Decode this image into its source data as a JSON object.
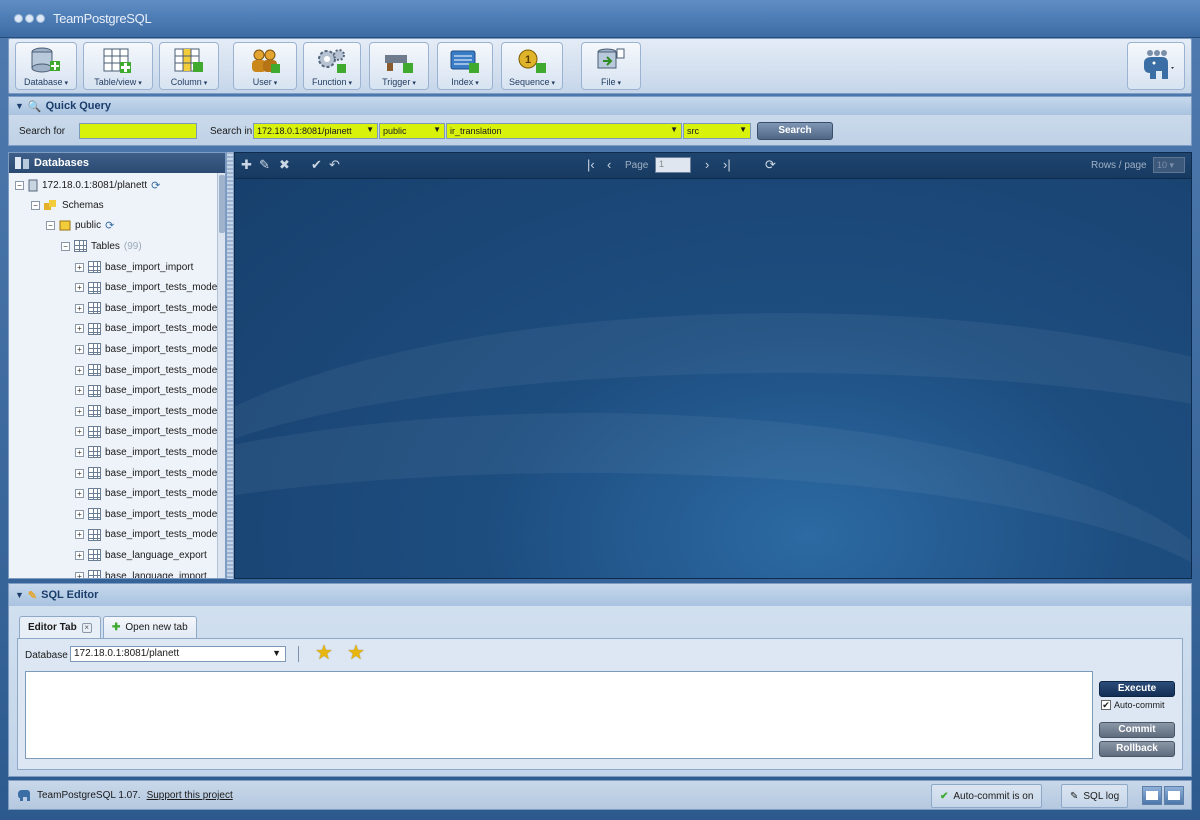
{
  "app": {
    "title": "TeamPostgreSQL"
  },
  "toolbar": {
    "buttons": [
      {
        "label": "Database",
        "icon": "database-add-icon"
      },
      {
        "label": "Table/view",
        "icon": "table-add-icon"
      },
      {
        "label": "Column",
        "icon": "column-add-icon"
      },
      {
        "label": "User",
        "icon": "users-icon"
      },
      {
        "label": "Function",
        "icon": "gears-icon"
      },
      {
        "label": "Trigger",
        "icon": "trigger-icon"
      },
      {
        "label": "Index",
        "icon": "index-icon"
      },
      {
        "label": "Sequence",
        "icon": "sequence-icon"
      },
      {
        "label": "File",
        "icon": "file-export-icon"
      }
    ]
  },
  "quick_query": {
    "title": "Quick Query",
    "search_for_label": "Search for",
    "search_for_value": "",
    "search_in_label": "Search in",
    "database_value": "172.18.0.1:8081/planett",
    "schema_value": "public",
    "table_value": "ir_translation",
    "column_value": "src",
    "search_button": "Search"
  },
  "databases": {
    "title": "Databases",
    "connection": "172.18.0.1:8081/planett",
    "schemas_label": "Schemas",
    "schema_name": "public",
    "tables_label": "Tables",
    "tables_count": "(99)",
    "tables": [
      "base_import_import",
      "base_import_tests_models",
      "base_import_tests_models",
      "base_import_tests_models",
      "base_import_tests_models",
      "base_import_tests_models",
      "base_import_tests_models",
      "base_import_tests_models",
      "base_import_tests_models",
      "base_import_tests_models",
      "base_import_tests_models",
      "base_import_tests_models",
      "base_import_tests_models",
      "base_import_tests_models",
      "base_language_export",
      "base_language_import"
    ]
  },
  "grid": {
    "page_label": "Page",
    "page_value": "1",
    "rows_label": "Rows / page",
    "rows_value": "10"
  },
  "sql_editor": {
    "title": "SQL Editor",
    "tab_label": "Editor Tab",
    "new_tab_label": "Open new tab",
    "database_label": "Database",
    "database_value": "172.18.0.1:8081/planett",
    "query": "",
    "execute_label": "Execute",
    "autocommit_label": "Auto-commit",
    "commit_label": "Commit",
    "rollback_label": "Rollback"
  },
  "status": {
    "version_text": "TeamPostgreSQL 1.07.",
    "support_link": "Support this project",
    "autocommit_status": "Auto-commit is on",
    "sql_log": "SQL log"
  }
}
